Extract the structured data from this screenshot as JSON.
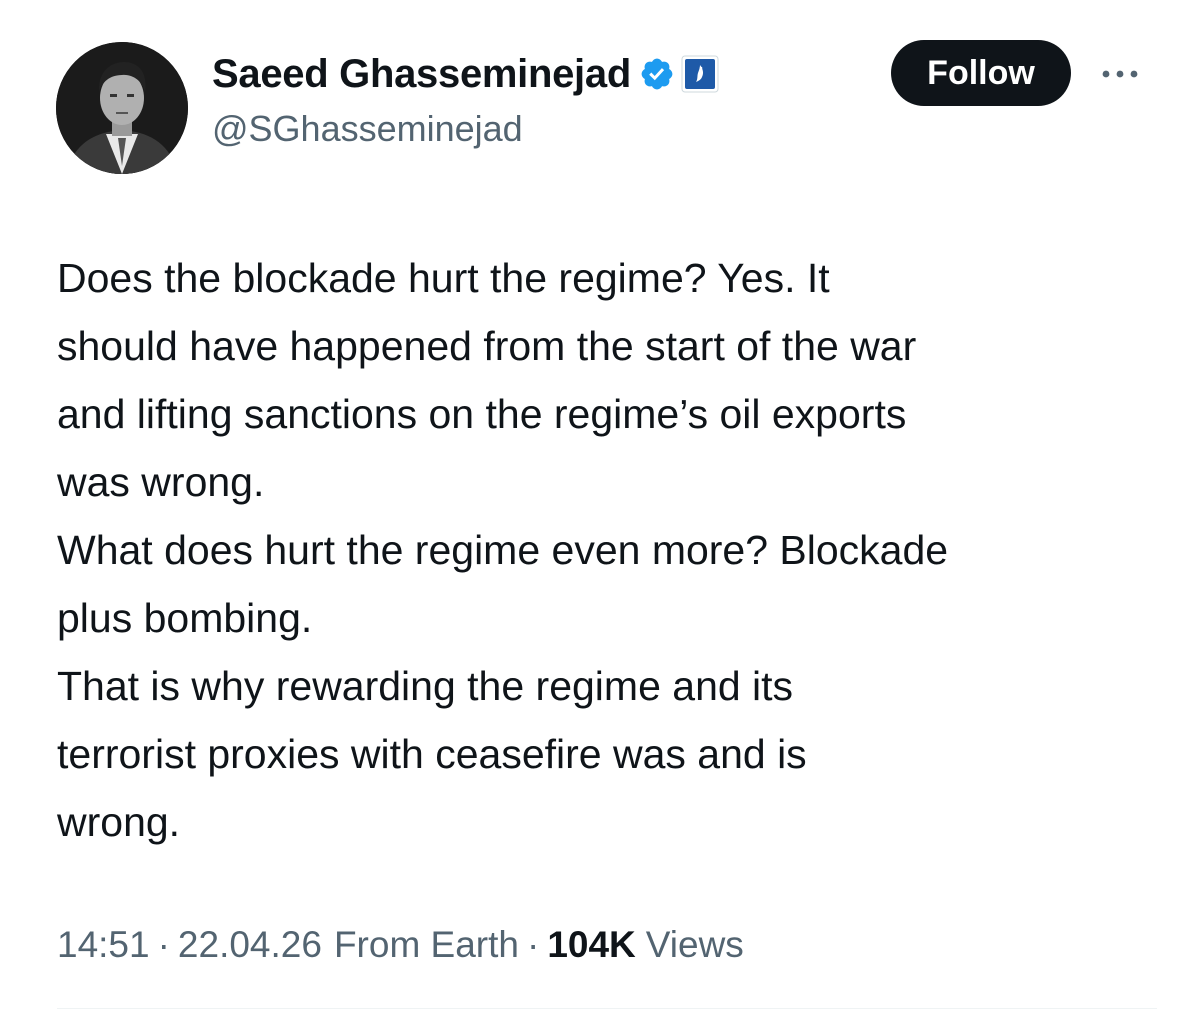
{
  "author": {
    "display_name": "Saeed Ghasseminejad",
    "handle": "@SGhasseminejad",
    "verified_icon": "verified-badge-icon",
    "affiliation_icon": "affiliation-badge-icon",
    "avatar": "avatar"
  },
  "actions": {
    "follow_label": "Follow",
    "more_icon": "more-icon"
  },
  "tweet": {
    "lines": [
      "Does the blockade hurt the regime? Yes. It",
      "should have happened from the start of the war",
      "and lifting sanctions on the regime’s oil exports",
      "was wrong.",
      "What does hurt the regime even more? Blockade",
      "plus bombing.",
      "That is why rewarding the regime and its",
      "terrorist proxies with ceasefire was and is",
      "wrong."
    ]
  },
  "meta": {
    "time": "14:51",
    "separator": "·",
    "date": "22.04.26",
    "source": "From Earth",
    "views_count": "104K",
    "views_label": "Views"
  },
  "colors": {
    "text": "#0f1419",
    "secondary_text": "#536471",
    "verified_blue": "#1d9bf0",
    "follow_bg": "#0f1419",
    "affiliation_bg": "#1e5aa8"
  }
}
